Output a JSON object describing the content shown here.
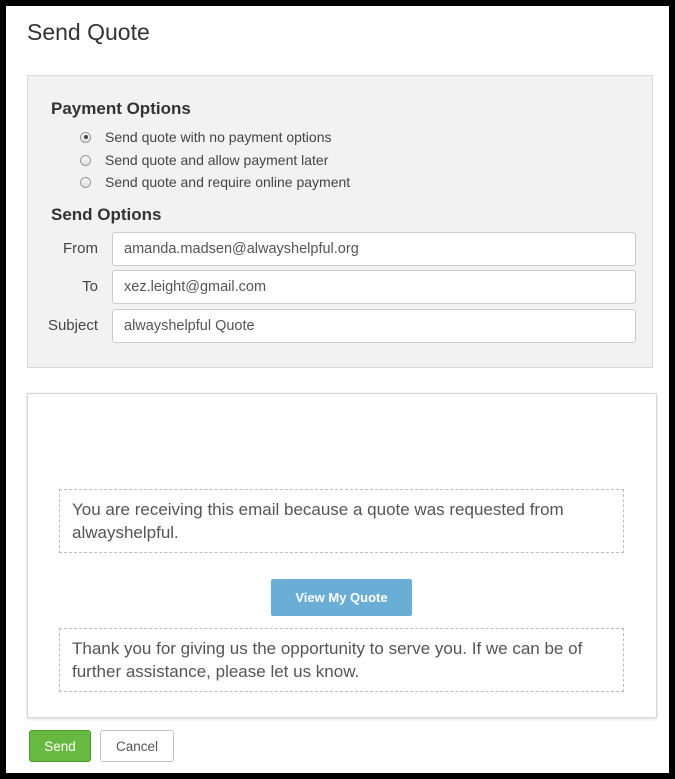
{
  "page": {
    "title": "Send Quote"
  },
  "payment_options": {
    "heading": "Payment Options",
    "selected_index": 0,
    "options": [
      {
        "label": "Send quote with no payment options",
        "checked": true
      },
      {
        "label": "Send quote and allow payment later",
        "checked": false
      },
      {
        "label": "Send quote and require online payment",
        "checked": false
      }
    ]
  },
  "send_options": {
    "heading": "Send Options",
    "from": {
      "label": "From",
      "value": "amanda.madsen@alwayshelpful.org"
    },
    "to": {
      "label": "To",
      "value": "xez.leight@gmail.com"
    },
    "subject": {
      "label": "Subject",
      "value": "alwayshelpful Quote"
    }
  },
  "email_preview": {
    "intro_text": "You are receiving this email because a quote was requested from alwayshelpful.",
    "view_quote_label": "View My Quote",
    "closing_text": "Thank you for giving us the opportunity to serve you. If we can be of further assistance, please let us know."
  },
  "actions": {
    "send_label": "Send",
    "cancel_label": "Cancel"
  },
  "colors": {
    "send_button": "#67b93f",
    "view_quote_button": "#6aaed6",
    "panel_background": "#f2f2f2"
  }
}
